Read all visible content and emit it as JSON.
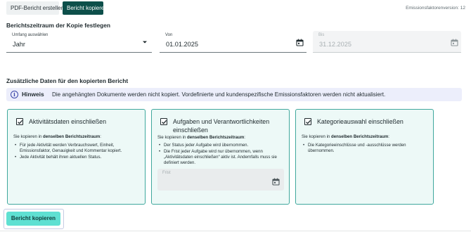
{
  "topbar": {
    "pdf_tab": "PDF-Bericht erstellen",
    "copy_tab": "Bericht kopieren",
    "version": "Emissionsfaktorenversion: 12"
  },
  "period": {
    "heading": "Berichtszeitraum der Kopie festlegen",
    "scope_label": "Umfang auswählen",
    "scope_value": "Jahr",
    "from_label": "Von",
    "from_value": "01.01.2025",
    "to_label": "Bis",
    "to_value": "31.12.2025"
  },
  "additional": {
    "heading": "Zusätzliche Daten für den kopierten Bericht",
    "info_title": "Hinweis",
    "info_text": "Die angehängten Dokumente werden nicht kopiert. Vordefinierte und kundenspezifische Emissionsfaktoren werden nicht aktualisiert."
  },
  "cards": [
    {
      "title": "Aktivitätsdaten einschließen",
      "checked": true,
      "intro_prefix": "Sie kopieren in ",
      "intro_bold": "denselben Berichtszeitraum",
      "intro_suffix": ":",
      "bullets": [
        "Für jede Aktivität werden Verbrauchswert, Einheit, Emissionsfaktor, Genauigkeit und Kommentar kopiert.",
        "Jede Aktivität behält ihren aktuellen Status."
      ]
    },
    {
      "title": "Aufgaben und Verantwortlichkeiten einschließen",
      "checked": true,
      "intro_prefix": "Sie kopieren in ",
      "intro_bold": "denselben Berichtszeitraum",
      "intro_suffix": ":",
      "bullets": [
        "Der Status jeder Aufgabe wird übernommen.",
        "Die Frist jeder Aufgabe wird nur übernommen, wenn „Aktivitätsdaten einschließen“ aktiv ist. Andernfalls muss sie definiert werden."
      ],
      "deadline_label": "Frist"
    },
    {
      "title": "Kategorieauswahl einschließen",
      "checked": true,
      "intro_prefix": "Sie kopieren in ",
      "intro_bold": "denselben Berichtszeitraum",
      "intro_suffix": ":",
      "bullets": [
        "Die Kategorieeinschlüsse und -ausschlüsse werden übernommen."
      ]
    }
  ],
  "actions": {
    "copy_button": "Bericht kopieren"
  },
  "icons": {
    "dropdown": "chevron-down-icon",
    "calendar": "calendar-icon",
    "info": "info-icon",
    "checkbox": "checkmark-icon"
  },
  "colors": {
    "primary_dark": "#0d4f4a",
    "accent_button": "#5fe0d2",
    "card_border": "#3fa89d",
    "card_bg": "#edf9f7",
    "info_bg": "#eceefb",
    "info_icon": "#3b46a8"
  }
}
